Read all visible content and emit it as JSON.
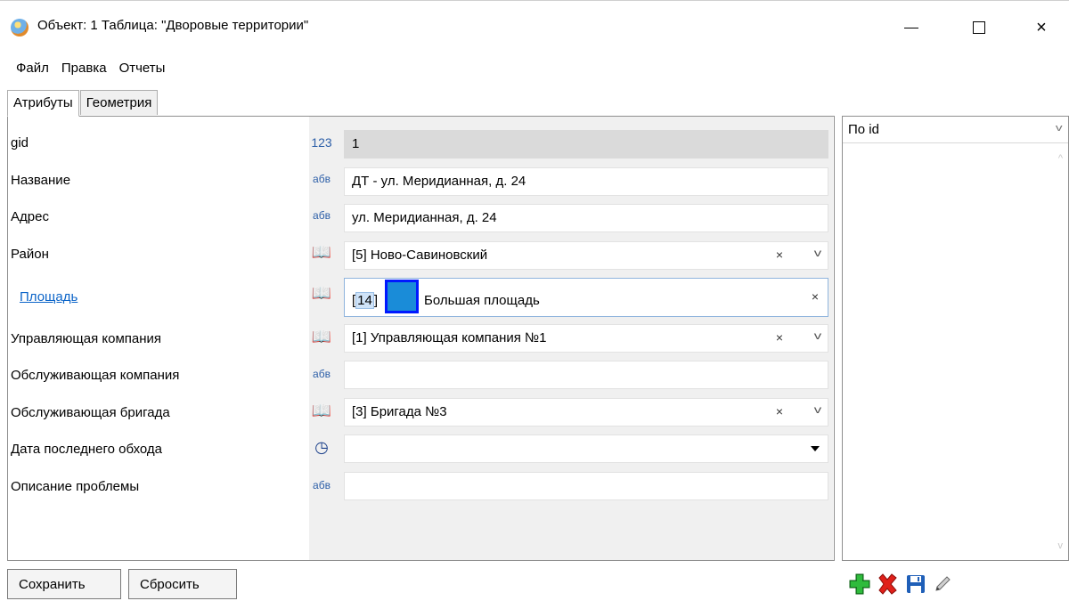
{
  "window": {
    "title": "Объект: 1 Таблица: \"Дворовые территории\"",
    "icon": "globe-icon",
    "controls": {
      "minimize": "minimize-icon",
      "maximize": "maximize-icon",
      "close": "×"
    }
  },
  "menu": [
    "Файл",
    "Правка",
    "Отчеты"
  ],
  "tabs": [
    {
      "label": "Атрибуты",
      "active": true
    },
    {
      "label": "Геометрия",
      "active": false
    }
  ],
  "fields": [
    {
      "label": "gid",
      "type_icon": "123",
      "value": "1",
      "readonly": true
    },
    {
      "label": "Название",
      "type_icon": "абв",
      "value": "ДТ - ул. Меридианная, д. 24"
    },
    {
      "label": "Адрес",
      "type_icon": "абв",
      "value": "ул. Меридианная, д. 24"
    },
    {
      "label": "Район",
      "type_icon": "book-icon",
      "value": "[5] Ново-Савиновский",
      "clear": "×",
      "dropdown": true
    },
    {
      "label": "Площадь",
      "type_icon": "book-icon",
      "id_bracket_open": "[",
      "id_value": "14",
      "id_bracket_close": "]",
      "swatch_color": "#1a8cd8",
      "value": "Большая площадь",
      "clear": "×",
      "focused": true
    },
    {
      "label": "Управляющая компания",
      "type_icon": "book-icon",
      "value": "[1] Управляющая компания №1",
      "clear": "×",
      "dropdown": true
    },
    {
      "label": "Обслуживающая компания",
      "type_icon": "абв",
      "value": ""
    },
    {
      "label": "Обслуживающая бригада",
      "type_icon": "book-icon",
      "value": "[3] Бригада №3",
      "clear": "×",
      "dropdown": true
    },
    {
      "label": "Дата последнего обхода",
      "type_icon": "clock-icon",
      "value": "",
      "date_dropdown": true
    },
    {
      "label": "Описание проблемы",
      "type_icon": "абв",
      "value": ""
    }
  ],
  "right_panel": {
    "sort_value": "По id"
  },
  "buttons": {
    "save": "Сохранить",
    "reset": "Сбросить"
  },
  "toolbar": [
    "add-icon",
    "delete-icon",
    "save-icon",
    "edit-icon"
  ],
  "colors": {
    "accent_link": "#0b64c8",
    "add_green": "#1f9e2c",
    "delete_red": "#e0201a",
    "save_blue": "#1f5fb8"
  }
}
